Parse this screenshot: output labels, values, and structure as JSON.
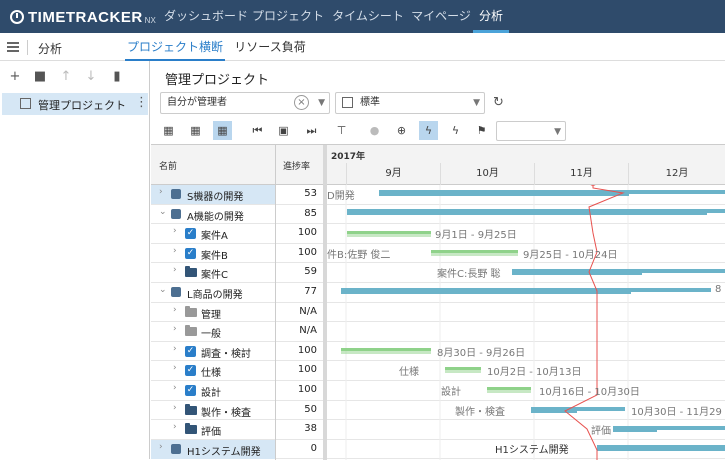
{
  "app": {
    "logo_text": "TIMETRACKER",
    "logo_suffix": "NX"
  },
  "nav": {
    "items": [
      {
        "label": "ダッシュボード"
      },
      {
        "label": "プロジェクト"
      },
      {
        "label": "タイムシート"
      },
      {
        "label": "マイページ"
      },
      {
        "label": "分析",
        "active": true
      }
    ]
  },
  "subnav": {
    "title": "分析",
    "tabs": [
      {
        "label": "プロジェクト横断",
        "active": true
      },
      {
        "label": "リソース負荷"
      }
    ]
  },
  "left_panel": {
    "toolbar": [
      "plus-icon",
      "folder-icon",
      "arrow-up-icon",
      "arrow-down-icon",
      "trash-icon"
    ],
    "tree_item": {
      "label": "管理プロジェクト"
    }
  },
  "main": {
    "title": "管理プロジェクト",
    "filter": {
      "value": "自分が管理者"
    },
    "view": {
      "value": "標準"
    },
    "toolbar_icons": [
      "calendar-icon",
      "calendar-week-icon",
      "calendar-month-icon",
      "first-icon",
      "today-icon",
      "last-icon",
      "hierarchy-icon",
      "pin-icon",
      "download-icon",
      "lightning-icon",
      "lightning-a-icon",
      "flag-icon"
    ]
  },
  "grid": {
    "col_name": "名前",
    "col_progress": "進捗率",
    "year_label": "2017年",
    "months": [
      "9月",
      "10月",
      "11月",
      "12月"
    ],
    "rows": [
      {
        "name": "S機器の開発",
        "pct": "53",
        "icon": "project",
        "exp": ">",
        "indent": 0,
        "hl": true
      },
      {
        "name": "A機能の開発",
        "pct": "85",
        "icon": "project",
        "exp": "v",
        "indent": 0
      },
      {
        "name": "案件A",
        "pct": "100",
        "icon": "check",
        "exp": ">",
        "indent": 1
      },
      {
        "name": "案件B",
        "pct": "100",
        "icon": "check",
        "exp": ">",
        "indent": 1
      },
      {
        "name": "案件C",
        "pct": "59",
        "icon": "folder",
        "exp": ">",
        "indent": 1
      },
      {
        "name": "L商品の開発",
        "pct": "77",
        "icon": "project",
        "exp": "v",
        "indent": 0
      },
      {
        "name": "管理",
        "pct": "N/A",
        "icon": "folder-gray",
        "exp": ">",
        "indent": 1
      },
      {
        "name": "一般",
        "pct": "N/A",
        "icon": "folder-gray",
        "exp": ">",
        "indent": 1
      },
      {
        "name": "調査・検討",
        "pct": "100",
        "icon": "check",
        "exp": ">",
        "indent": 1
      },
      {
        "name": "仕様",
        "pct": "100",
        "icon": "check",
        "exp": ">",
        "indent": 1
      },
      {
        "name": "設計",
        "pct": "100",
        "icon": "check",
        "exp": ">",
        "indent": 1
      },
      {
        "name": "製作・検査",
        "pct": "50",
        "icon": "folder",
        "exp": ">",
        "indent": 1
      },
      {
        "name": "評価",
        "pct": "38",
        "icon": "folder",
        "exp": ">",
        "indent": 1
      },
      {
        "name": "H1システム開発",
        "pct": "0",
        "icon": "project",
        "exp": ">",
        "indent": 0,
        "hl": true
      }
    ]
  },
  "gantt": {
    "labels": {
      "s_left": "D開発",
      "a_date": "9月1日 - 9月25日",
      "b_left": "件B:佐野 俊二",
      "b_date": "9月25日 - 10月24日",
      "c_left": "案件C:長野 聡",
      "l_right": "8",
      "chosa_date": "8月30日 - 9月26日",
      "shiyo_left": "仕様",
      "shiyo_date": "10月2日 - 10月13日",
      "sekkei_left": "設計",
      "sekkei_date": "10月16日 - 10月30日",
      "seisaku_left": "製作・検査",
      "seisaku_date": "10月30日 - 11月29",
      "hyoka_left": "評価",
      "h1_left": "H1システム開発"
    },
    "colors": {
      "bar_blue": "#6bb3c9",
      "bar_green": "#8fd28a",
      "progress_line": "#e8524f"
    }
  }
}
